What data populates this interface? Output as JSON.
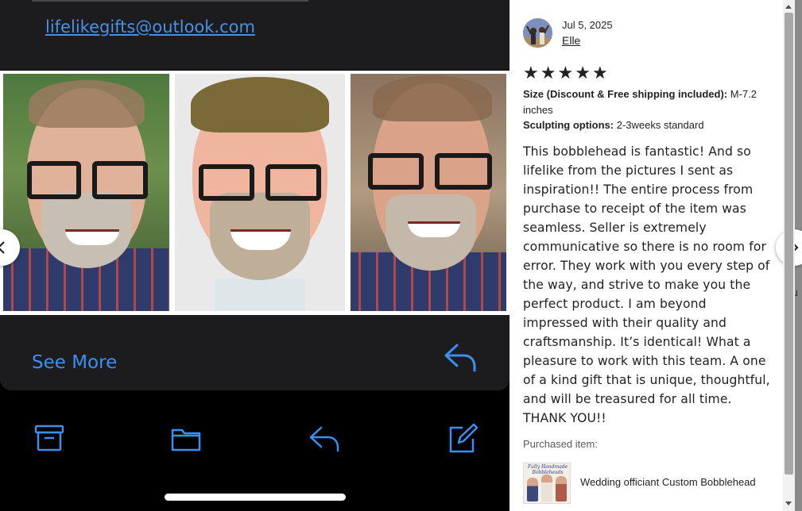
{
  "photo": {
    "email": "lifelikegifts@outlook.com",
    "see_more_label": "See More"
  },
  "review": {
    "date": "Jul 5, 2025",
    "author": "Elle",
    "rating": 5,
    "stars": "★★★★★",
    "size_label": "Size (Discount & Free shipping included):",
    "size_value": "M-7.2 inches",
    "sculpt_label": "Sculpting options:",
    "sculpt_value": "2-3weeks standard",
    "text": "This bobblehead is fantastic! And so lifelike from the pictures I sent as inspiration!! The entire process from purchase to receipt of the item was seamless. Seller is extremely communicative so there is no room for error. They work with you every step of the way, and strive to make you the perfect product. I am beyond impressed with their quality and craftsmanship. It’s identical! What a pleasure to work with this team. A one of a kind gift that is unique, thoughtful, and will be treasured for all time. THANK YOU!!",
    "purchased_label": "Purchased item:",
    "item_title": "Wedding officiant Custom Bobblehead",
    "thumb_caption": "Fully Handmade Bobbleheads"
  },
  "background_page": {
    "fragments": [
      "y",
      "ou"
    ]
  },
  "colors": {
    "link_blue": "#4a90e2",
    "ios_blue": "#3b8ff0",
    "panel_bg": "#ffffff"
  }
}
